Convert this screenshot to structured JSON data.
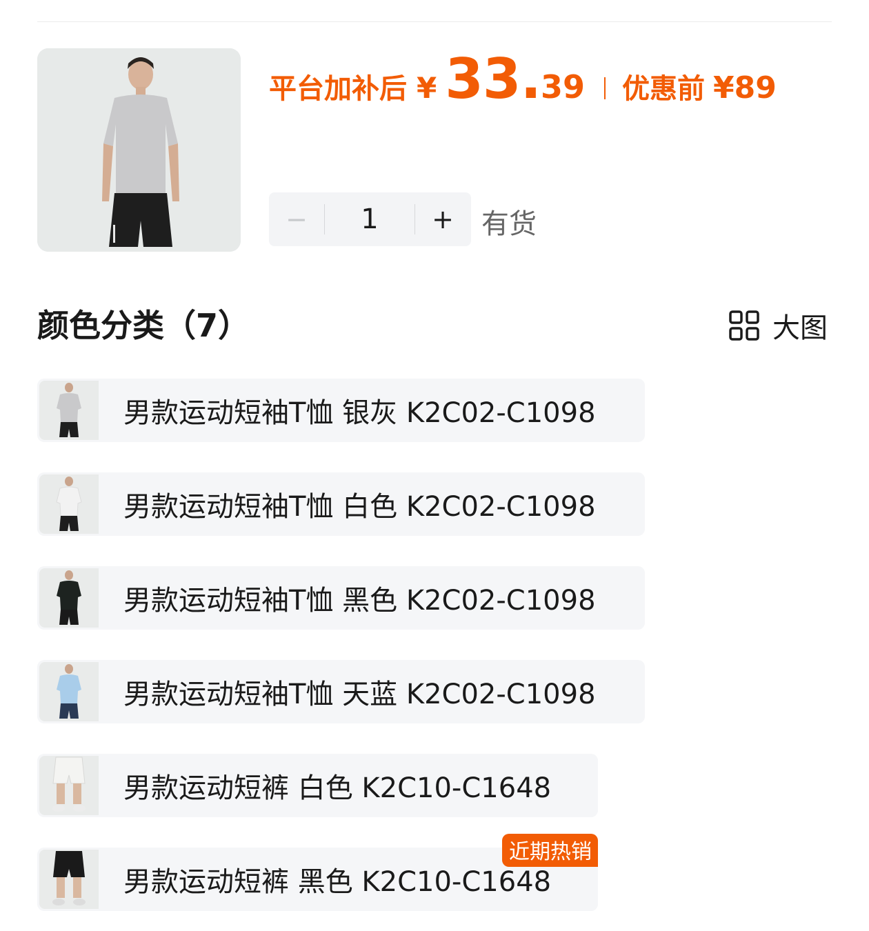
{
  "price": {
    "label": "平台加补后",
    "symbol": "¥",
    "integer": "33.",
    "decimal": "39",
    "original_label": "优惠前",
    "original_price": "¥89",
    "color": "#f25c05"
  },
  "quantity": {
    "minus": "−",
    "value": "1",
    "plus": "+",
    "stock": "有货"
  },
  "color_section": {
    "title": "颜色分类（7）",
    "big_view_label": "大图"
  },
  "variants": [
    {
      "label": "男款运动短袖T恤 银灰 K2C02-C1098",
      "shirt_color": "#c9c9cb",
      "shorts_color": "#1e1e1e"
    },
    {
      "label": "男款运动短袖T恤 白色 K2C02-C1098",
      "shirt_color": "#f2f2f2",
      "shorts_color": "#1e1e1e"
    },
    {
      "label": "男款运动短袖T恤 黑色 K2C02-C1098",
      "shirt_color": "#1d2320",
      "shorts_color": "#1a1a1a"
    },
    {
      "label": "男款运动短袖T恤 天蓝 K2C02-C1098",
      "shirt_color": "#a9cdea",
      "shorts_color": "#2a3a55"
    },
    {
      "label": "男款运动短裤 白色 K2C10-C1648",
      "shirt_color": "#f4f4f2",
      "shorts_color": "#e6e6e4"
    },
    {
      "label": "男款运动短裤 黑色 K2C10-C1648",
      "shirt_color": "#1a1a1a",
      "shorts_color": "#1a1a1a",
      "badge": "近期热销"
    }
  ]
}
